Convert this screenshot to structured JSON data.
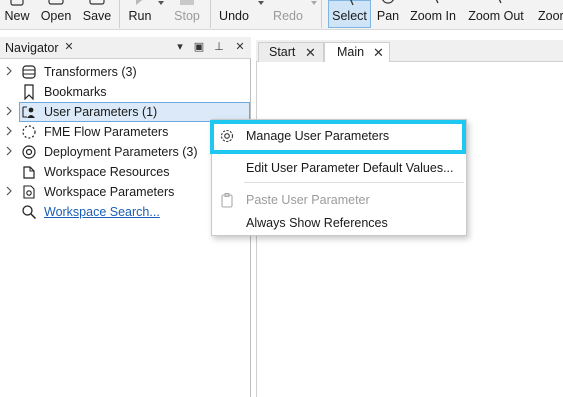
{
  "toolbar": {
    "new": "New",
    "open": "Open",
    "save": "Save",
    "run": "Run",
    "stop": "Stop",
    "undo": "Undo",
    "redo": "Redo",
    "select": "Select",
    "pan": "Pan",
    "zoom_in": "Zoom In",
    "zoom_out": "Zoom Out",
    "zoom_cut": "Zoor"
  },
  "navigator": {
    "title": "Navigator",
    "items": [
      {
        "label": "Transformers (3)",
        "icon": "stack-icon",
        "expandable": true
      },
      {
        "label": "Bookmarks",
        "icon": "bookmark-icon",
        "expandable": false
      },
      {
        "label": "User Parameters (1)",
        "icon": "user-parameters-icon",
        "expandable": true
      },
      {
        "label": "FME Flow Parameters",
        "icon": "flow-parameters-icon",
        "expandable": true
      },
      {
        "label": "Deployment Parameters (3)",
        "icon": "deployment-icon",
        "expandable": true
      },
      {
        "label": "Workspace Resources",
        "icon": "resources-icon",
        "expandable": false
      },
      {
        "label": "Workspace Parameters",
        "icon": "workspace-parameters-icon",
        "expandable": true
      },
      {
        "label": "Workspace Search...",
        "icon": "search-icon",
        "expandable": false
      }
    ]
  },
  "tabs": [
    {
      "label": "Start",
      "active": false
    },
    {
      "label": "Main",
      "active": true
    }
  ],
  "context_menu": {
    "items": [
      {
        "label": "Manage User Parameters",
        "enabled": true,
        "icon": "gear-icon"
      },
      {
        "label": "Edit User Parameter Default Values...",
        "enabled": true
      },
      {
        "label": "Paste User Parameter",
        "enabled": false,
        "icon": "clipboard-icon"
      },
      {
        "label": "Always Show References",
        "enabled": true
      }
    ]
  },
  "colors": {
    "highlight_border": "#1ec8f0",
    "selection": "#dbe9f8",
    "link": "#1a5fb4"
  }
}
